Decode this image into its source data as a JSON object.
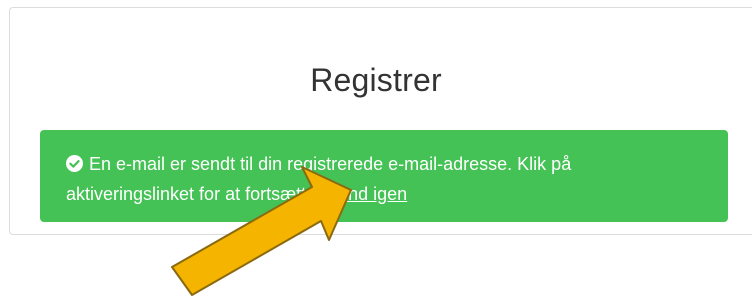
{
  "page": {
    "title": "Registrer"
  },
  "alert": {
    "icon": "check-circle-icon",
    "message": "En e-mail er sendt til din registrerede e-mail-adresse. Klik på aktiveringslinket for at fortsætte.",
    "link_label": "Send igen",
    "background_color": "#45c255",
    "text_color": "#ffffff"
  },
  "annotation": {
    "icon": "pointer-arrow-icon",
    "color": "#f5b400",
    "outline_color": "#8a6a10"
  }
}
